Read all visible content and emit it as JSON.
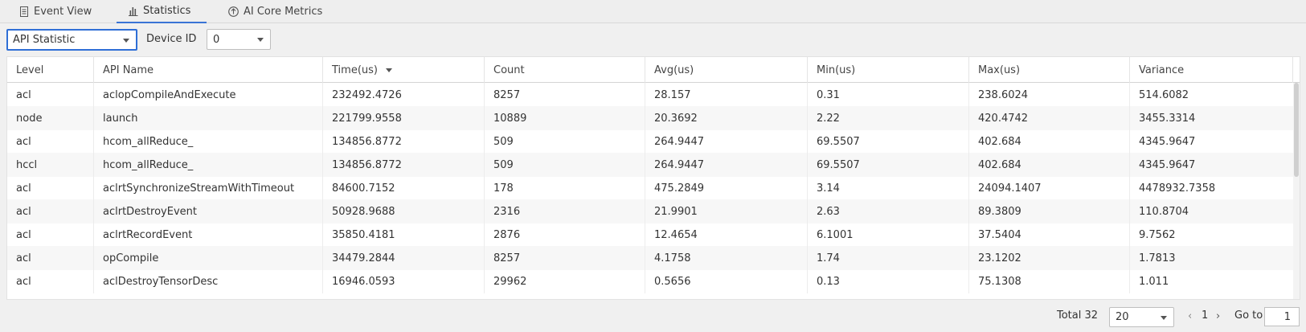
{
  "tabs": [
    {
      "label": "Event View",
      "icon": "document-icon",
      "active": false
    },
    {
      "label": "Statistics",
      "icon": "bar-chart-icon",
      "active": true
    },
    {
      "label": "AI Core Metrics",
      "icon": "ai-core-icon",
      "active": false
    }
  ],
  "filters": {
    "stat_type": "API Statistic",
    "device_label": "Device ID",
    "device_value": "0"
  },
  "table": {
    "columns": [
      "Level",
      "API Name",
      "Time(us)",
      "Count",
      "Avg(us)",
      "Min(us)",
      "Max(us)",
      "Variance"
    ],
    "sorted_column": "Time(us)",
    "rows": [
      [
        "acl",
        "aclopCompileAndExecute",
        "232492.4726",
        "8257",
        "28.157",
        "0.31",
        "238.6024",
        "514.6082"
      ],
      [
        "node",
        "launch",
        "221799.9558",
        "10889",
        "20.3692",
        "2.22",
        "420.4742",
        "3455.3314"
      ],
      [
        "acl",
        "hcom_allReduce_",
        "134856.8772",
        "509",
        "264.9447",
        "69.5507",
        "402.684",
        "4345.9647"
      ],
      [
        "hccl",
        "hcom_allReduce_",
        "134856.8772",
        "509",
        "264.9447",
        "69.5507",
        "402.684",
        "4345.9647"
      ],
      [
        "acl",
        "aclrtSynchronizeStreamWithTimeout",
        "84600.7152",
        "178",
        "475.2849",
        "3.14",
        "24094.1407",
        "4478932.7358"
      ],
      [
        "acl",
        "aclrtDestroyEvent",
        "50928.9688",
        "2316",
        "21.9901",
        "2.63",
        "89.3809",
        "110.8704"
      ],
      [
        "acl",
        "aclrtRecordEvent",
        "35850.4181",
        "2876",
        "12.4654",
        "6.1001",
        "37.5404",
        "9.7562"
      ],
      [
        "acl",
        "opCompile",
        "34479.2844",
        "8257",
        "4.1758",
        "1.74",
        "23.1202",
        "1.7813"
      ],
      [
        "acl",
        "aclDestroyTensorDesc",
        "16946.0593",
        "29962",
        "0.5656",
        "0.13",
        "75.1308",
        "1.011"
      ]
    ]
  },
  "pagination": {
    "total_label": "Total 32",
    "page_size": "20",
    "current_page": "1",
    "prev": "‹",
    "next": "›",
    "goto_label": "Go to",
    "goto_value": "1"
  },
  "colors": {
    "accent": "#3a74d6"
  }
}
